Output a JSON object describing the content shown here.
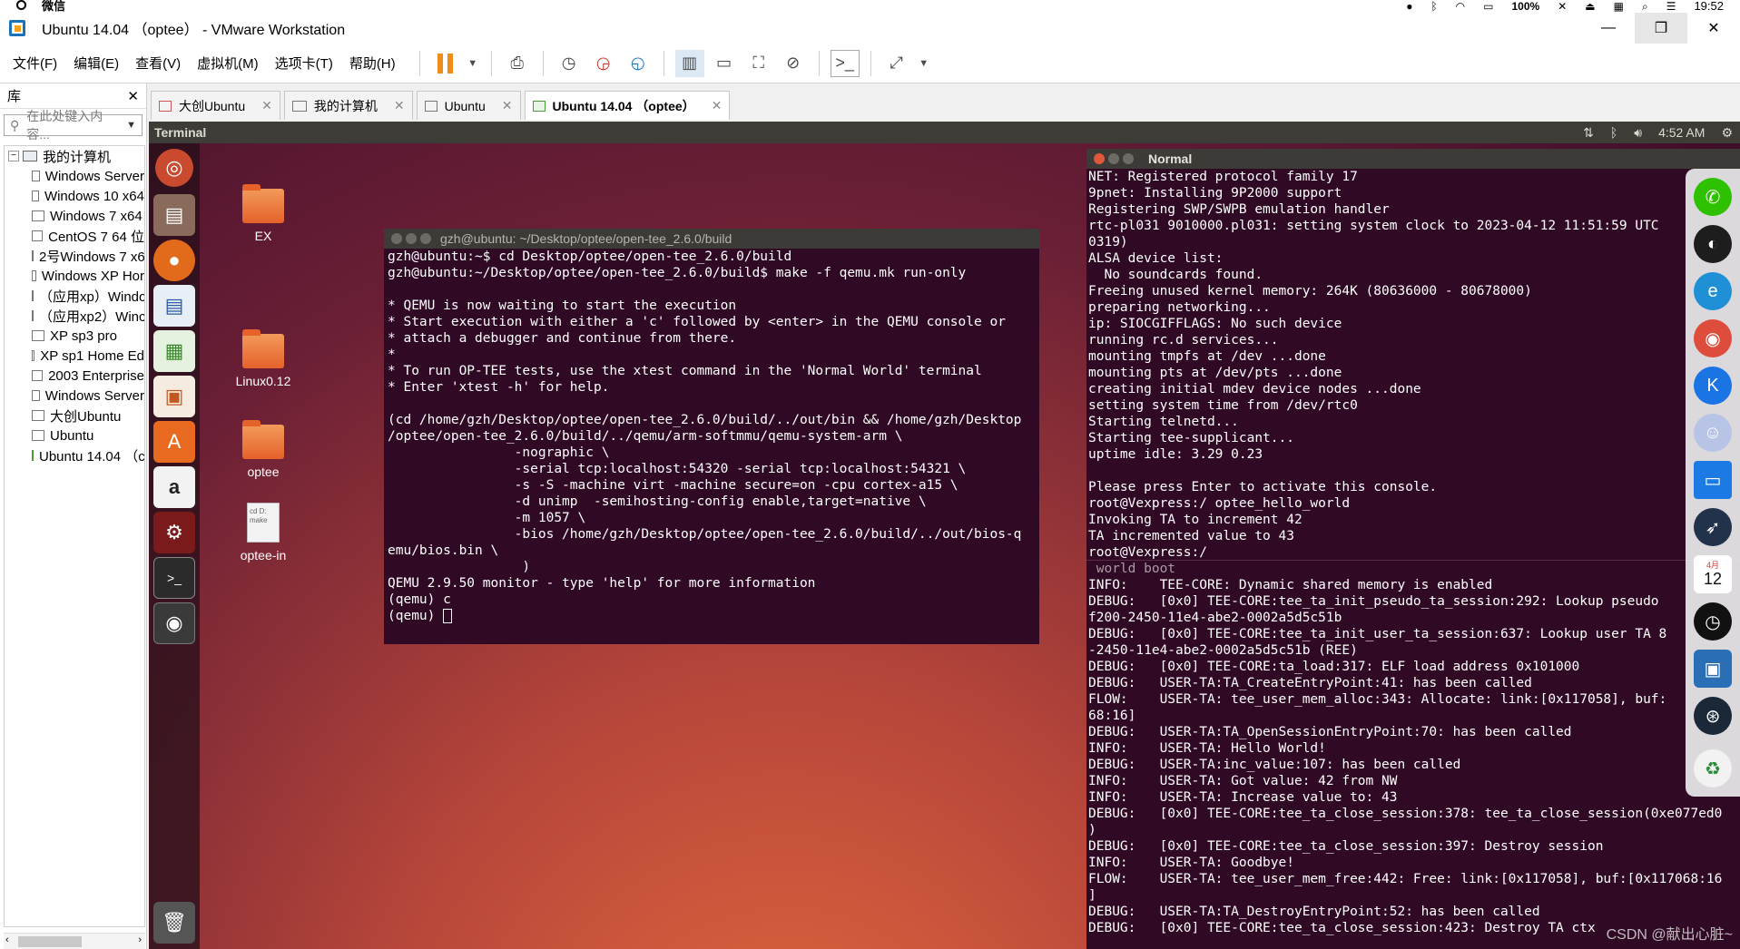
{
  "statusbar": {
    "app": "微信",
    "battery": "100%",
    "time": "19:52"
  },
  "window": {
    "title": "Ubuntu 14.04 （optee） - VMware Workstation",
    "minimize": "—",
    "maximize": "❐",
    "close": "✕"
  },
  "menu": [
    "文件(F)",
    "编辑(E)",
    "查看(V)",
    "虚拟机(M)",
    "选项卡(T)",
    "帮助(H)"
  ],
  "library": {
    "title": "库",
    "close": "✕",
    "search_placeholder": "在此处键入内容...",
    "root": "我的计算机",
    "items": [
      "Windows Server",
      "Windows 10 x64",
      "Windows 7 x64",
      "CentOS 7 64 位",
      "2号Windows 7 x6",
      "Windows XP Hor",
      "（应用xp）Windo",
      "（应用xp2）Winc",
      "XP sp3 pro",
      "XP sp1 Home Ed",
      "2003 Enterprise",
      "Windows Server",
      "大创Ubuntu",
      "Ubuntu",
      "Ubuntu 14.04 （c"
    ]
  },
  "tabs": [
    {
      "label": "大创Ubuntu",
      "close": "✕"
    },
    {
      "label": "我的计算机",
      "close": "✕"
    },
    {
      "label": "Ubuntu",
      "close": "✕"
    },
    {
      "label": "Ubuntu 14.04 （optee）",
      "close": "✕"
    }
  ],
  "ubuntu": {
    "topbar_app": "Terminal",
    "clock": "4:52 AM",
    "desktop_icons": [
      "EX",
      "Linux0.12",
      "optee",
      "optee-in"
    ],
    "doc_preview": "cd D:\nmake"
  },
  "term1": {
    "title": "gzh@ubuntu: ~/Desktop/optee/open-tee_2.6.0/build",
    "lines": [
      "gzh@ubuntu:~$ cd Desktop/optee/open-tee_2.6.0/build",
      "gzh@ubuntu:~/Desktop/optee/open-tee_2.6.0/build$ make -f qemu.mk run-only",
      "",
      "* QEMU is now waiting to start the execution",
      "* Start execution with either a 'c' followed by <enter> in the QEMU console or",
      "* attach a debugger and continue from there.",
      "*",
      "* To run OP-TEE tests, use the xtest command in the 'Normal World' terminal",
      "* Enter 'xtest -h' for help.",
      "",
      "(cd /home/gzh/Desktop/optee/open-tee_2.6.0/build/../out/bin && /home/gzh/Desktop",
      "/optee/open-tee_2.6.0/build/../qemu/arm-softmmu/qemu-system-arm \\",
      "                -nographic \\",
      "                -serial tcp:localhost:54320 -serial tcp:localhost:54321 \\",
      "                -s -S -machine virt -machine secure=on -cpu cortex-a15 \\",
      "                -d unimp  -semihosting-config enable,target=native \\",
      "                -m 1057 \\",
      "                -bios /home/gzh/Desktop/optee/open-tee_2.6.0/build/../out/bios-q",
      "emu/bios.bin \\",
      "                 )",
      "QEMU 2.9.50 monitor - type 'help' for more information",
      "(qemu) c",
      "(qemu) "
    ]
  },
  "term2": {
    "title": "Normal",
    "upper_lines": [
      "NET: Registered protocol family 17",
      "9pnet: Installing 9P2000 support",
      "Registering SWP/SWPB emulation handler",
      "rtc-pl031 9010000.pl031: setting system clock to 2023-04-12 11:51:59 UTC",
      "0319)",
      "ALSA device list:",
      "  No soundcards found.",
      "Freeing unused kernel memory: 264K (80636000 - 80678000)",
      "preparing networking...",
      "ip: SIOCGIFFLAGS: No such device",
      "running rc.d services...",
      "mounting tmpfs at /dev ...done",
      "mounting pts at /dev/pts ...done",
      "creating initial mdev device nodes ...done",
      "setting system time from /dev/rtc0",
      "Starting telnetd...",
      "Starting tee-supplicant...",
      "uptime idle: 3.29 0.23",
      "",
      "Please press Enter to activate this console.",
      "root@Vexpress:/ optee_hello_world",
      "Invoking TA to increment 42",
      "TA incremented value to 43",
      "root@Vexpress:/"
    ],
    "lower_header": " world boot",
    "lower_lines": [
      "INFO:    TEE-CORE: Dynamic shared memory is enabled",
      "DEBUG:   [0x0] TEE-CORE:tee_ta_init_pseudo_ta_session:292: Lookup pseudo",
      "f200-2450-11e4-abe2-0002a5d5c51b",
      "DEBUG:   [0x0] TEE-CORE:tee_ta_init_user_ta_session:637: Lookup user TA 8",
      "-2450-11e4-abe2-0002a5d5c51b (REE)",
      "DEBUG:   [0x0] TEE-CORE:ta_load:317: ELF load address 0x101000",
      "DEBUG:   USER-TA:TA_CreateEntryPoint:41: has been called",
      "FLOW:    USER-TA: tee_user_mem_alloc:343: Allocate: link:[0x117058], buf:",
      "68:16]",
      "DEBUG:   USER-TA:TA_OpenSessionEntryPoint:70: has been called",
      "INFO:    USER-TA: Hello World!",
      "DEBUG:   USER-TA:inc_value:107: has been called",
      "INFO:    USER-TA: Got value: 42 from NW",
      "INFO:    USER-TA: Increase value to: 43",
      "DEBUG:   [0x0] TEE-CORE:tee_ta_close_session:378: tee_ta_close_session(0xe077ed0",
      ")",
      "DEBUG:   [0x0] TEE-CORE:tee_ta_close_session:397: Destroy session",
      "INFO:    USER-TA: Goodbye!",
      "FLOW:    USER-TA: tee_user_mem_free:442: Free: link:[0x117058], buf:[0x117068:16",
      "]",
      "DEBUG:   USER-TA:TA_DestroyEntryPoint:52: has been called",
      "DEBUG:   [0x0] TEE-CORE:tee_ta_close_session:423: Destroy TA ctx"
    ]
  },
  "dock": {
    "calendar_month": "4月",
    "calendar_day": "12"
  },
  "watermark": "CSDN @献出心脏~",
  "colors": {
    "terminal_bg": "#300a24",
    "ubuntu_bar": "#3d3c37",
    "pause_orange": "#f08c1a"
  }
}
